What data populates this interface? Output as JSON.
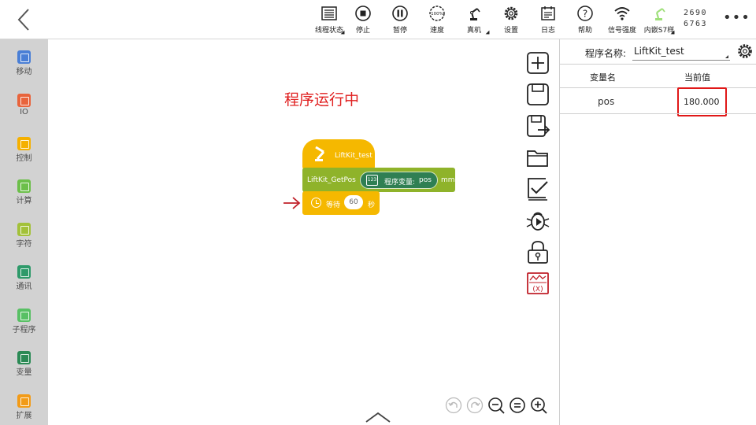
{
  "toolbar": {
    "items": [
      {
        "label": "线程状态",
        "icon": "thread-status-icon"
      },
      {
        "label": "停止",
        "icon": "stop-icon"
      },
      {
        "label": "暂停",
        "icon": "pause-icon"
      },
      {
        "label": "速度",
        "icon": "speed-gauge-icon",
        "value": "100%"
      },
      {
        "label": "真机",
        "icon": "robot-arm-icon"
      },
      {
        "label": "设置",
        "icon": "gear-icon"
      },
      {
        "label": "日志",
        "icon": "log-icon"
      },
      {
        "label": "帮助",
        "icon": "help-icon"
      },
      {
        "label": "信号强度",
        "icon": "wifi-icon"
      },
      {
        "label": "内嵌S7样",
        "icon": "embedded-robot-icon"
      }
    ],
    "numbers_line1": "2690",
    "numbers_line2": "6763",
    "more": "•••"
  },
  "sidebar": {
    "items": [
      {
        "label": "移动",
        "color": "#4a7fd6"
      },
      {
        "label": "IO",
        "color": "#e8643c"
      },
      {
        "label": "控制",
        "color": "#f5b000"
      },
      {
        "label": "计算",
        "color": "#6cbf4a"
      },
      {
        "label": "字符",
        "color": "#a3c13a"
      },
      {
        "label": "通讯",
        "color": "#2e9a6a"
      },
      {
        "label": "子程序",
        "color": "#58c064"
      },
      {
        "label": "变量",
        "color": "#2b8a55"
      },
      {
        "label": "扩展",
        "color": "#f29b18"
      }
    ]
  },
  "canvas": {
    "status": "程序运行中",
    "blocks": {
      "hat_name": "LiftKit_test",
      "get_name": "LiftKit_GetPos",
      "var_icon": "123",
      "var_label": "程序变量:",
      "var_value": "pos",
      "unit": "mm",
      "wait_label": "等待",
      "wait_value": "60",
      "wait_unit": "秒"
    }
  },
  "panel": {
    "program_name_label": "程序名称:",
    "program_name": "LiftKit_test",
    "col_name": "变量名",
    "col_value": "当前值",
    "rows": [
      {
        "name": "pos",
        "value": "180.000"
      }
    ]
  }
}
